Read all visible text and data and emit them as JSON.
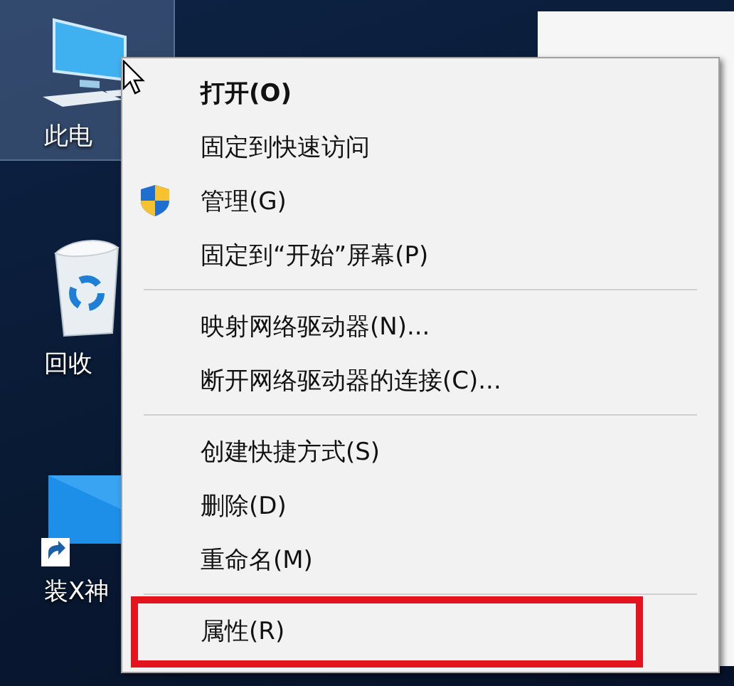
{
  "desktop": {
    "icons": [
      {
        "kind": "computer",
        "label": "此电",
        "selected": true
      },
      {
        "kind": "recycle_bin",
        "label": "回收",
        "selected": false
      },
      {
        "kind": "shortcut",
        "label": "装X神",
        "selected": false
      }
    ]
  },
  "context_menu": {
    "items": [
      {
        "kind": "item",
        "label": "打开(O)",
        "default": true,
        "highlighted": false
      },
      {
        "kind": "item",
        "label": "固定到快速访问",
        "default": false,
        "highlighted": false
      },
      {
        "kind": "elevated",
        "label": "管理(G)",
        "default": false,
        "highlighted": false
      },
      {
        "kind": "item",
        "label": "固定到“开始”屏幕(P)",
        "default": false,
        "highlighted": false
      },
      {
        "kind": "separator"
      },
      {
        "kind": "item",
        "label": "映射网络驱动器(N)...",
        "default": false,
        "highlighted": false
      },
      {
        "kind": "item",
        "label": "断开网络驱动器的连接(C)...",
        "default": false,
        "highlighted": false
      },
      {
        "kind": "separator"
      },
      {
        "kind": "item",
        "label": "创建快捷方式(S)",
        "default": false,
        "highlighted": false
      },
      {
        "kind": "item",
        "label": "删除(D)",
        "default": false,
        "highlighted": false
      },
      {
        "kind": "item",
        "label": "重命名(M)",
        "default": false,
        "highlighted": false
      },
      {
        "kind": "separator"
      },
      {
        "kind": "item",
        "label": "属性(R)",
        "default": false,
        "highlighted": true
      }
    ]
  }
}
